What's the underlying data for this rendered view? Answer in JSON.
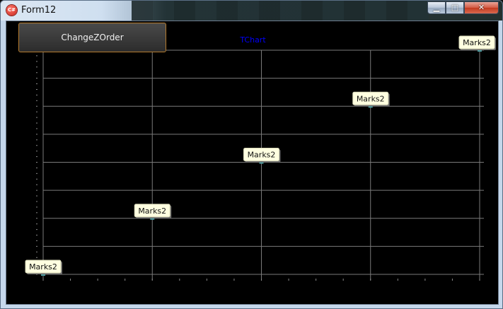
{
  "window": {
    "title": "Form12"
  },
  "controls": {
    "minimize": "▁",
    "maximize": "□",
    "close": "✕"
  },
  "toolbar": {
    "button_label": "ChangeZOrder"
  },
  "chart_data": {
    "type": "scatter",
    "title": "TChart",
    "grid": true,
    "series": [
      {
        "points": [
          {
            "x": 0,
            "y": 0,
            "label": "Marks2"
          },
          {
            "x": 1,
            "y": 1,
            "label": "Marks2"
          },
          {
            "x": 2,
            "y": 2,
            "label": "Marks2"
          },
          {
            "x": 3,
            "y": 3,
            "label": "Marks2"
          },
          {
            "x": 4,
            "y": 4,
            "label": "Marks2"
          }
        ]
      }
    ],
    "xlim": [
      0,
      4
    ],
    "ylim": [
      0,
      4
    ],
    "background": "#000000",
    "grid_color": "#7a7a7a",
    "mark_fill": "#ffffe0",
    "title_color": "#0000ff"
  }
}
